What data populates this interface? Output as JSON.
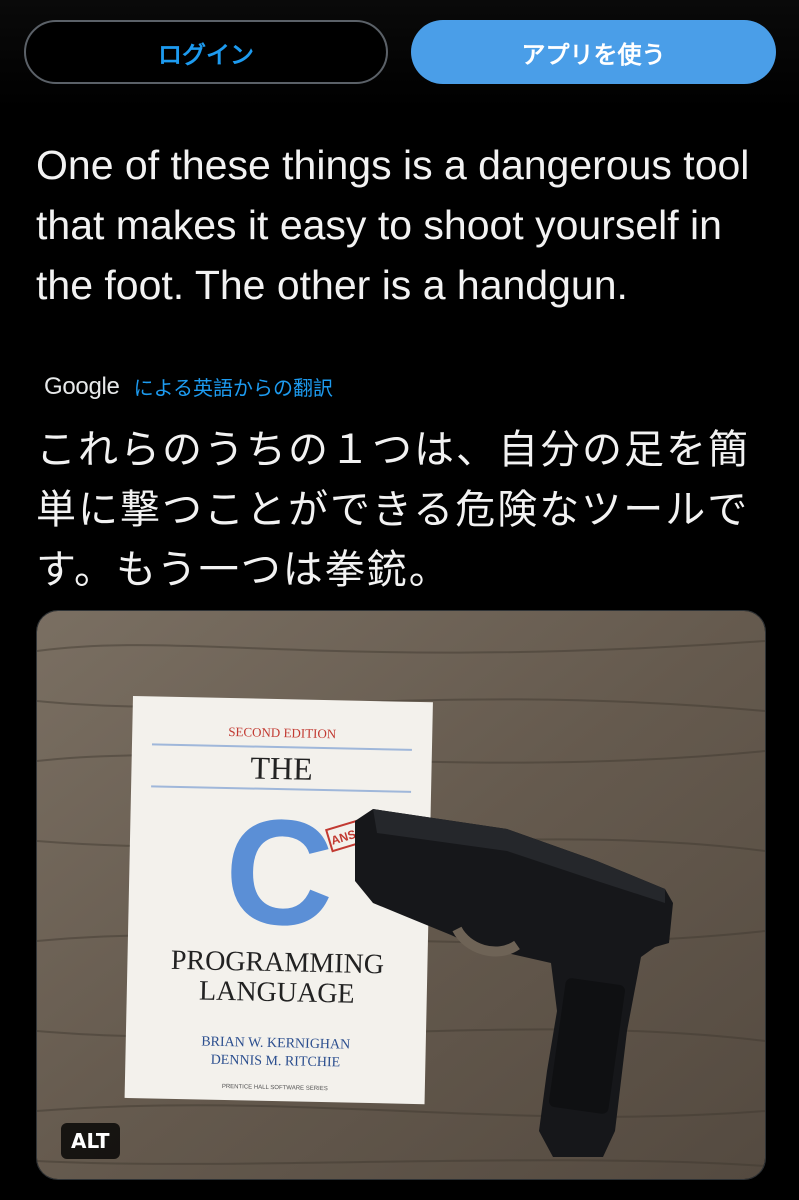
{
  "header": {
    "login_label": "ログイン",
    "app_label": "アプリを使う"
  },
  "tweet": {
    "text": "One of these things is a dangerous tool that makes it easy to shoot yourself in the foot. The other is a handgun.",
    "translation": {
      "provider": "Google",
      "link_label": "による英語からの翻訳",
      "text": "これらのうちの１つは、自分の足を簡単に撃つことができる危険なツールです。もう一つは拳銃。"
    }
  },
  "media": {
    "alt_badge": "ALT",
    "book": {
      "edition": "SECOND EDITION",
      "the": "THE",
      "letter": "C",
      "title_line1": "PROGRAMMING",
      "title_line2": "LANGUAGE",
      "author1": "BRIAN W. KERNIGHAN",
      "author2": "DENNIS M. RITCHIE",
      "series": "PRENTICE HALL SOFTWARE SERIES",
      "stamp": "ANSI C"
    },
    "colors": {
      "wood": "#6e6356",
      "book_cover": "#f3f1ec",
      "c_blue": "#5b8fd6",
      "edition_red": "#c23a32",
      "gun": "#16171a"
    }
  }
}
